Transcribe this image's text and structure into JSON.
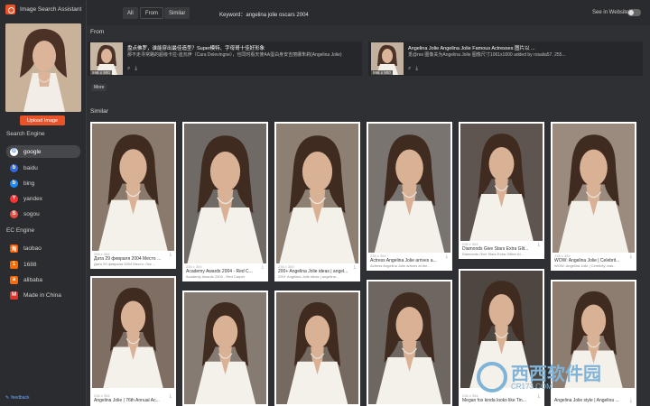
{
  "app": {
    "title": "Image Search Assistant"
  },
  "sidebar": {
    "upload_label": "Upload Image",
    "search_engine_title": "Search Engine",
    "engines": [
      {
        "label": "google",
        "color": "#4285f4",
        "glyph": "G",
        "active": true
      },
      {
        "label": "baidu",
        "color": "#2f6ae0",
        "glyph": "b",
        "active": false
      },
      {
        "label": "bing",
        "color": "#1a8cff",
        "glyph": "b",
        "active": false
      },
      {
        "label": "yandex",
        "color": "#ff3333",
        "glyph": "Y",
        "active": false
      },
      {
        "label": "sogou",
        "color": "#e84c3d",
        "glyph": "S",
        "active": false
      }
    ],
    "ec_engine_title": "EC Engine",
    "ec_engines": [
      {
        "label": "taobao",
        "color": "#ff5a00",
        "glyph": "淘"
      },
      {
        "label": "1688",
        "color": "#ff6a00",
        "glyph": "1"
      },
      {
        "label": "alibaba",
        "color": "#ff6a00",
        "glyph": "a"
      },
      {
        "label": "Made in China",
        "color": "#e0332b",
        "glyph": "M"
      }
    ],
    "feedback_label": "feedback"
  },
  "topbar": {
    "tabs": [
      "All",
      "From",
      "Similar"
    ],
    "keyword_label": "Keyword：",
    "keyword_value": "angelina jolie oscars 2004",
    "see_in_website": "See in Website:"
  },
  "from_section": {
    "title": "From",
    "more_label": "More",
    "items": [
      {
        "title": "盘点佛罗，谁能穿出最佳造型？Super模特、字母哥十佳好形象",
        "desc": "那不走寻常路的超级卡拉-迪瓦伊（Cara Delevingne），也同时看天使AA蛋白身安吉丽娜朱莉(Angelina Jolie)",
        "size": "596 x 900"
      },
      {
        "title": "Angelina Jolie Angelina Jolie Famous Actresses 图片以 ...",
        "desc": "觅@res 图像关为Angelina Jolie 图像尺寸1061x1600 added by rosalia57. 255...",
        "size": "596 x 900"
      }
    ]
  },
  "similar_section": {
    "title": "Similar",
    "cards": [
      {
        "dims": "256 x 384",
        "title": "Дата 29 февраля 2004 Место ...",
        "sub": "Дата 29 февраля 2004 Место: Лос ..."
      },
      {
        "dims": "236 x 354",
        "title": "Academy Awards 2004 - Red C...",
        "sub": "Academy Awards 2004 - Red Carpet"
      },
      {
        "dims": "236 x 354",
        "title": "200+ Angelina Jolie ideas | angel...",
        "sub": "200+ Angelina Jolie ideas | angelina..."
      },
      {
        "dims": "236 x 354",
        "title": "Actress Angelina Jolie arrives a...",
        "sub": "Actress Angelina Jolie arrives at the..."
      },
      {
        "dims": "236 x 354",
        "title": "Diamonds Give Stars Extra Glit...",
        "sub": "Diamonds Give Stars Extra Glitter At ..."
      },
      {
        "dims": "236 x 354",
        "title": "WOW: Angelina Jolie | Celebrit...",
        "sub": "WOW: Angelina Jolie | Celebrity mak..."
      },
      {
        "dims": "236 x 354",
        "title": "Angelina Jolie | 76th Annual Ac...",
        "sub": ""
      },
      {
        "dims": "",
        "title": "",
        "sub": ""
      },
      {
        "dims": "",
        "title": "",
        "sub": ""
      },
      {
        "dims": "",
        "title": "",
        "sub": ""
      },
      {
        "dims": "236 x 354",
        "title": "Megan fox kinda looks like Tin...",
        "sub": ""
      },
      {
        "dims": "",
        "title": "Angelina Jolie style | Angelina ...",
        "sub": ""
      }
    ]
  },
  "watermark": {
    "text": "西西软件园",
    "sub": "CR173.COM"
  },
  "colors": {
    "accent": "#e8532a",
    "background": "#2f3033",
    "sidebar": "#2b2c2f",
    "active_engine": "#45474b"
  }
}
